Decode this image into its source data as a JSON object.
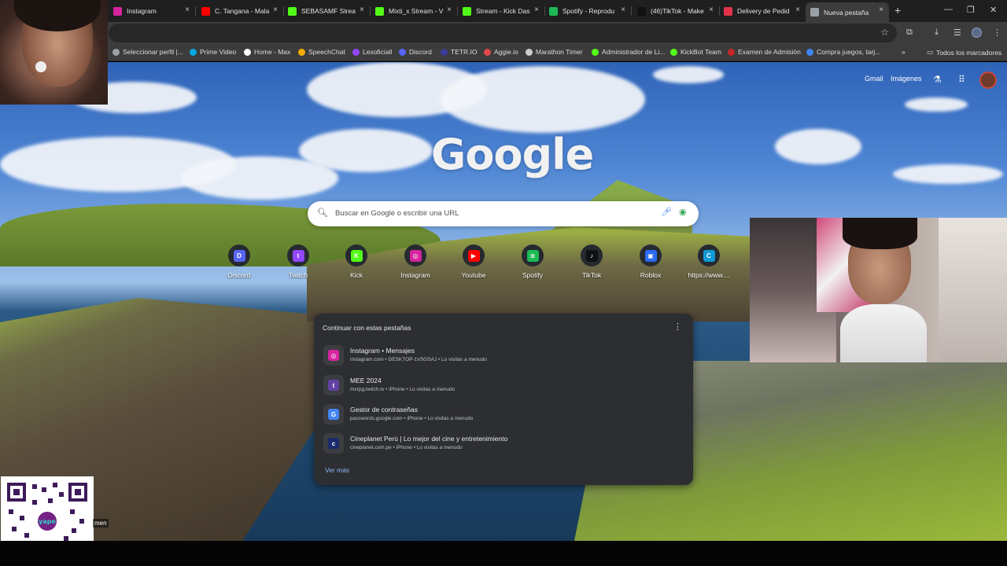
{
  "browser": {
    "tabs": [
      {
        "title": "Instagram",
        "icon": "instagram-icon",
        "color": "#d6249f"
      },
      {
        "title": "C. Tangana - Mala",
        "icon": "youtube-icon",
        "color": "#ff0000"
      },
      {
        "title": "SEBASAMF Strea",
        "icon": "kick-icon",
        "color": "#53fc18"
      },
      {
        "title": "Mixti_x Stream - V",
        "icon": "kick-icon",
        "color": "#53fc18"
      },
      {
        "title": "Stream - Kick Das",
        "icon": "kick-icon",
        "color": "#53fc18"
      },
      {
        "title": "Spotify - Reprodu",
        "icon": "spotify-icon",
        "color": "#1db954"
      },
      {
        "title": "(46)TikTok - Make",
        "icon": "tiktok-icon",
        "color": "#111111"
      },
      {
        "title": "Delivery de Pedid",
        "icon": "delivery-icon",
        "color": "#e2334b"
      },
      {
        "title": "Nueva pestaña",
        "icon": "chrome-icon",
        "color": "#9aa0a6"
      }
    ],
    "new_tab_symbol": "+",
    "close_symbol": "×",
    "window_controls": {
      "minimize": "—",
      "maximize": "❐",
      "close": "✕"
    }
  },
  "bookmarks": [
    {
      "label": "Seleccionar perfil |...",
      "color": "#9aa0a6"
    },
    {
      "label": "Prime Video",
      "color": "#00a8e1"
    },
    {
      "label": "Home - Max",
      "color": "#ffffff"
    },
    {
      "label": "SpeechChat",
      "color": "#f2a900"
    },
    {
      "label": "Lexoficiall",
      "color": "#9146ff"
    },
    {
      "label": "Discord",
      "color": "#5865f2"
    },
    {
      "label": "TETR.IO",
      "color": "#3b3b9b"
    },
    {
      "label": "Aggie.io",
      "color": "#e04848"
    },
    {
      "label": "Marathon Timer",
      "color": "#cccccc"
    },
    {
      "label": "Administrador de Li...",
      "color": "#53fc18"
    },
    {
      "label": "KickBot Team",
      "color": "#53fc18"
    },
    {
      "label": "Examen de Admisión",
      "color": "#c62828"
    },
    {
      "label": "Compra juegos, tarj...",
      "color": "#4285f4"
    }
  ],
  "bookmarks_overflow": "»",
  "all_bookmarks": "Todos los marcadores",
  "ntp": {
    "logo": "Google",
    "top_links": {
      "gmail": "Gmail",
      "images": "Imágenes"
    },
    "search_placeholder": "Buscar en Google o escribir una URL",
    "shortcuts": [
      {
        "label": "Discord",
        "color": "#5865f2",
        "glyph": "D"
      },
      {
        "label": "Twitch",
        "color": "#9146ff",
        "glyph": "t"
      },
      {
        "label": "Kick",
        "color": "#53fc18",
        "glyph": "K"
      },
      {
        "label": "Instagram",
        "color": "#d6249f",
        "glyph": "◎"
      },
      {
        "label": "Youtube",
        "color": "#ff0000",
        "glyph": "▶"
      },
      {
        "label": "Spotify",
        "color": "#1db954",
        "glyph": "≋"
      },
      {
        "label": "TikTok",
        "color": "#111111",
        "glyph": "♪"
      },
      {
        "label": "Roblox",
        "color": "#2b6bf3",
        "glyph": "▣"
      },
      {
        "label": "https://www....",
        "color": "#0f9ad6",
        "glyph": "C"
      }
    ],
    "continue_card": {
      "title": "Continuar con estas pestañas",
      "items": [
        {
          "title": "Instagram • Mensajes",
          "subtitle": "instagram.com • DESKTOP-1V5GSAJ • Lo visitas a menudo",
          "color": "#d6249f",
          "glyph": "◎"
        },
        {
          "title": "MEE 2024",
          "subtitle": "mxrpg.twitch.tv • iPhone • Lo visitas a menudo",
          "color": "#6441a5",
          "glyph": "t"
        },
        {
          "title": "Gestor de contraseñas",
          "subtitle": "passwords.google.com • iPhone • Lo visitas a menudo",
          "color": "#4285f4",
          "glyph": "G"
        },
        {
          "title": "Cineplanet Perú | Lo mejor del cine y entretenimiento",
          "subtitle": "cineplanet.com.pe • iPhone • Lo visitas a menudo",
          "color": "#1b2a6b",
          "glyph": "c"
        }
      ],
      "see_more": "Ver más"
    }
  },
  "overlay": {
    "qr_caption": "men",
    "qr_brand": "yape"
  }
}
